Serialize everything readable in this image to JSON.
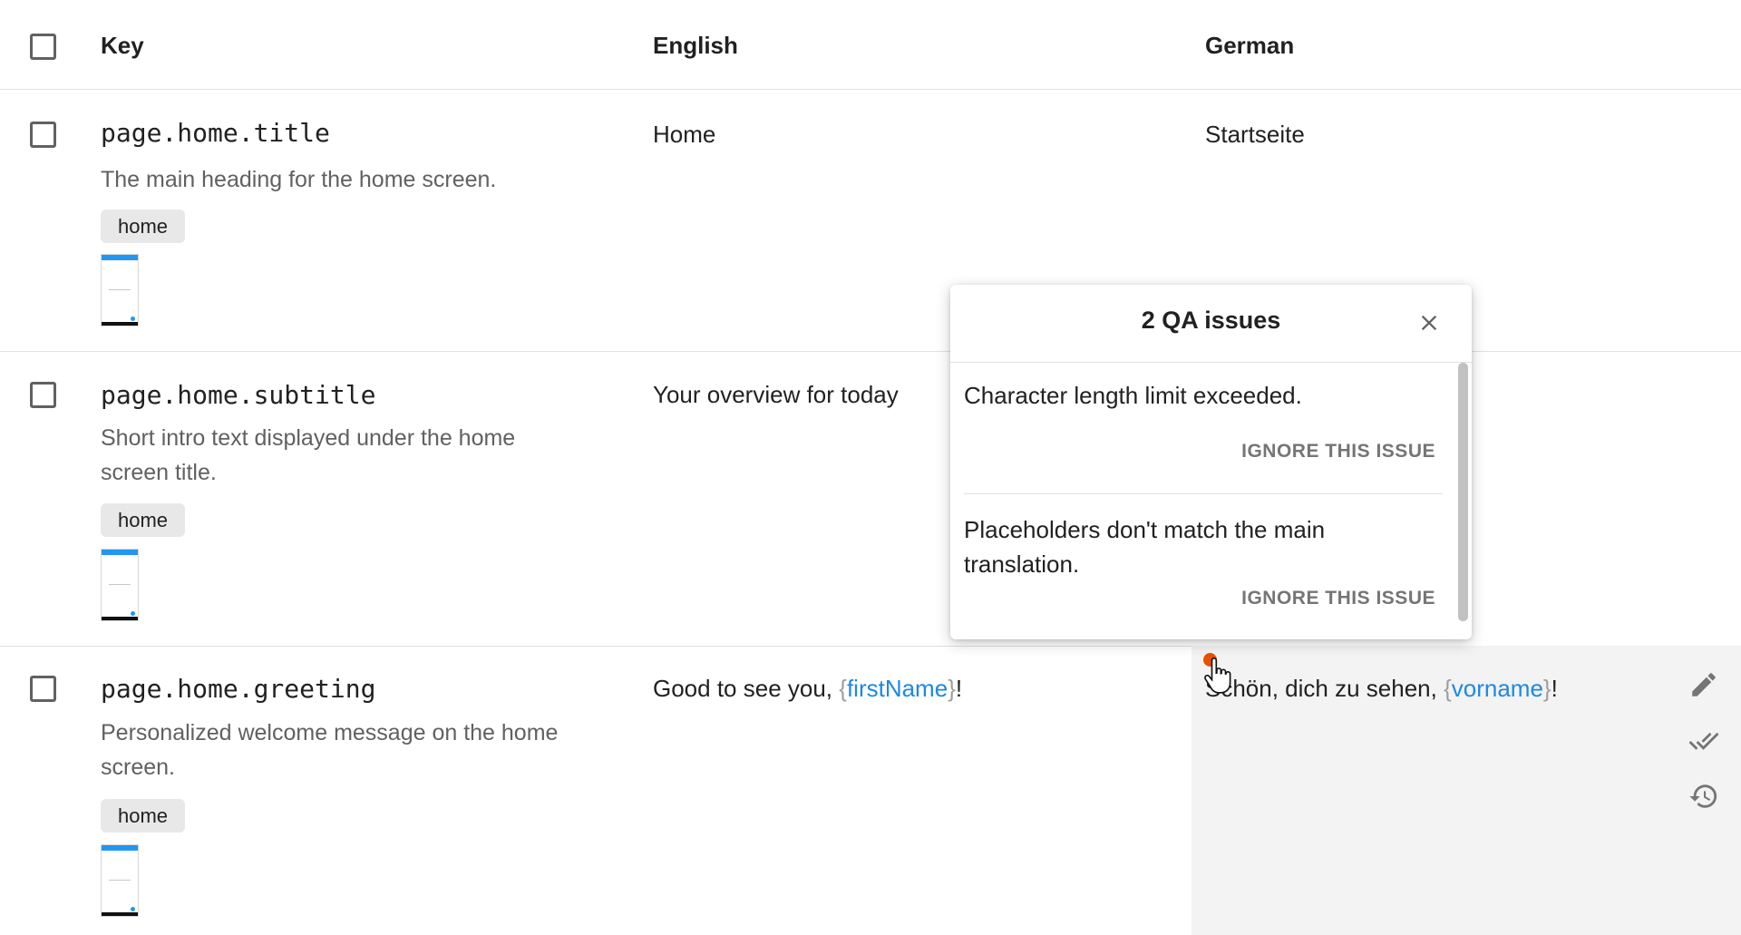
{
  "columns": {
    "key": "Key",
    "english": "English",
    "german": "German"
  },
  "rows": [
    {
      "key": "page.home.title",
      "description": "The main heading for the home screen.",
      "tag": "home",
      "english": "Home",
      "german": "Startseite"
    },
    {
      "key": "page.home.subtitle",
      "description": "Short intro text displayed under the home screen title.",
      "tag": "home",
      "english": "Your overview for today",
      "german": ""
    },
    {
      "key": "page.home.greeting",
      "description": "Personalized welcome message on the home screen.",
      "tag": "home",
      "english_prefix": "Good to see you, ",
      "english_placeholder": "firstName",
      "english_suffix": "!",
      "german_prefix": "Schön, dich zu sehen, ",
      "german_placeholder": "vorname",
      "german_suffix": "!"
    }
  ],
  "qa_popup": {
    "title": "2 QA issues",
    "issues": [
      {
        "message": "Character length limit exceeded.",
        "action": "IGNORE THIS ISSUE"
      },
      {
        "message": "Placeholders don't match the main translation.",
        "action": "IGNORE THIS ISSUE"
      }
    ]
  },
  "colors": {
    "placeholder": "#1e88e5",
    "qa_indicator": "#e65100",
    "thumbnail_accent": "#2196f3",
    "cell_highlight": "#f3f3f3"
  },
  "icons": [
    "close-icon",
    "edit-icon",
    "done-all-icon",
    "history-icon",
    "pointer-cursor-icon"
  ]
}
